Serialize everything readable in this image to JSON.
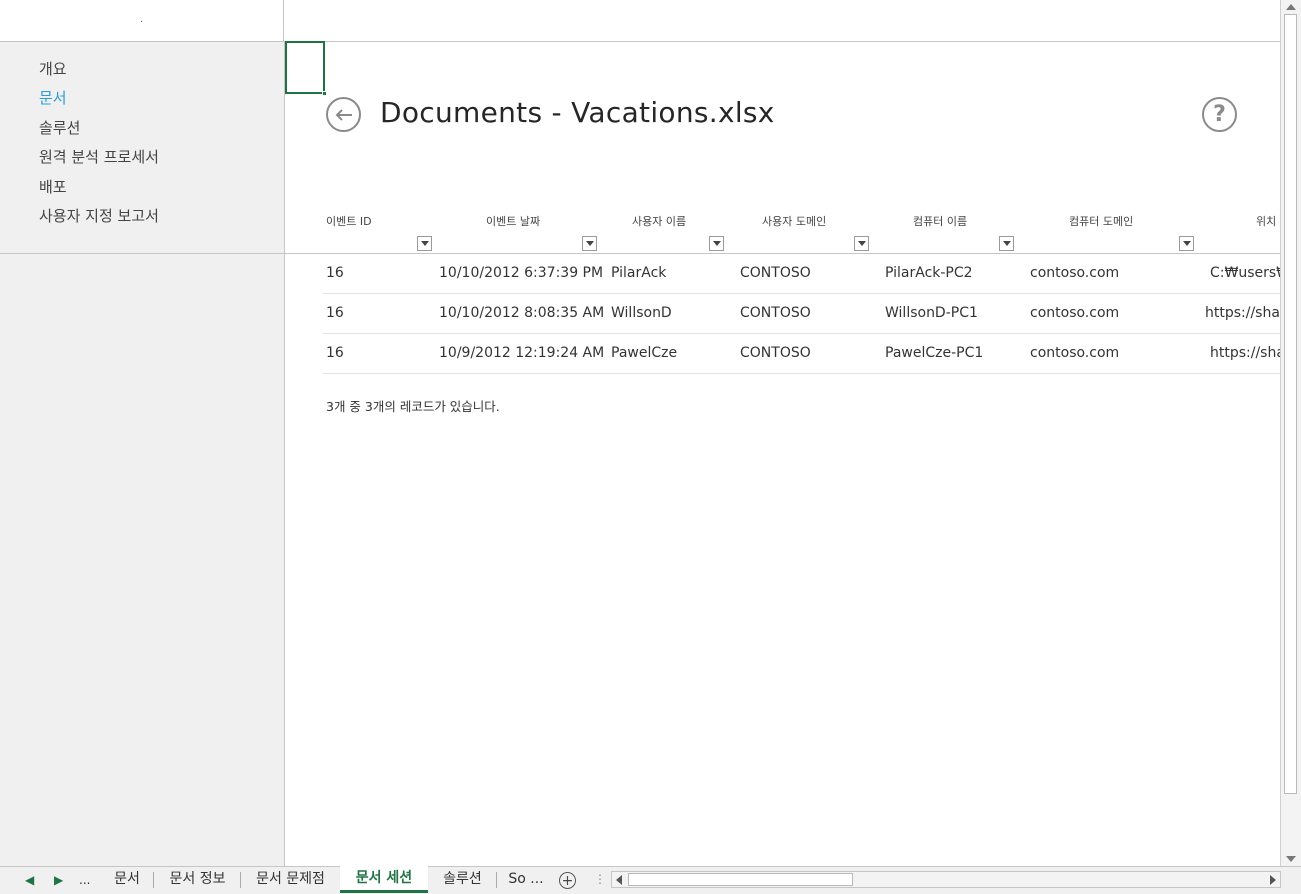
{
  "left_pane": {
    "dot": ".",
    "nav_items": [
      {
        "label": "개요"
      },
      {
        "label": "문서",
        "active": true
      },
      {
        "label": "솔루션"
      },
      {
        "label": "원격 분석 프로세서"
      },
      {
        "label": "배포"
      },
      {
        "label": "사용자 지정 보고서"
      }
    ]
  },
  "header": {
    "title": "Documents - Vacations.xlsx",
    "help_glyph": "?"
  },
  "table": {
    "columns": [
      "이벤트 ID",
      "이벤트 날짜",
      "사용자 이름",
      "사용자 도메인",
      "컴퓨터 이름",
      "컴퓨터 도메인",
      "위치"
    ],
    "rows": [
      [
        "16",
        "10/10/2012 6:37:39 PM",
        "PilarAck",
        "CONTOSO",
        "PilarAck-PC2",
        "contoso.com",
        "C:₩users₩"
      ],
      [
        "16",
        "10/10/2012 8:08:35 AM",
        "WillsonD",
        "CONTOSO",
        "WillsonD-PC1",
        "contoso.com",
        "https://sha"
      ],
      [
        "16",
        "10/9/2012 12:19:24 AM",
        "PawelCze",
        "CONTOSO",
        "PawelCze-PC1",
        "contoso.com",
        "https://sha"
      ]
    ],
    "record_count_text": "3개 중 3개의 레코드가 있습니다."
  },
  "sheet_tabs": {
    "nav_prev": "◀",
    "nav_next": "▶",
    "nav_more": "...",
    "tabs": [
      {
        "label": "문서"
      },
      {
        "label": "문서 정보"
      },
      {
        "label": "문서 문제점"
      },
      {
        "label": "문서 세션",
        "active": true
      },
      {
        "label": "솔루션"
      },
      {
        "label": "So ..."
      }
    ],
    "add_glyph": "+",
    "split_glyph": "⋮"
  },
  "colors": {
    "accent_green": "#217346",
    "nav_active_blue": "#2b9bd8",
    "pane_gray": "#f0f0f0"
  }
}
